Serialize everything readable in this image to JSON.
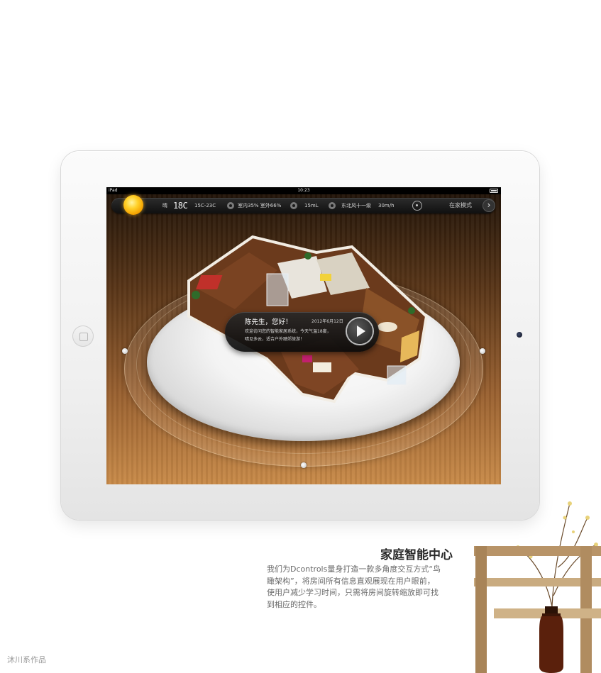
{
  "device": {
    "statusbar": {
      "carrier": "iPad",
      "time": "10:23"
    }
  },
  "toolbar": {
    "weather": "晴",
    "temperature": "18C",
    "temp_range": "15C-23C",
    "humidity": "室内35%  室外66%",
    "water": "15mL",
    "wind": "东北风十一级",
    "wind_speed": "30m/h",
    "mode": "在家模式",
    "next_icon": "›"
  },
  "card": {
    "greeting": "陈先生，您好！",
    "date": "2012年6月12日",
    "message_line1": "欢迎访问您的智能家居系统，今天气温18度，",
    "message_line2": "晴见多云，适合户外踏郊旅游！"
  },
  "caption": {
    "title": "家庭智能中心",
    "body": [
      "我们为Dcontrols量身打造一款多角度交互方式“鸟",
      "瞰架构”，将房间所有信息直观展现在用户眼前，",
      "使用户减少学习时间，只需将房间旋转缩放即可找",
      "到相应的控件。"
    ]
  },
  "signature": "沐川系作品",
  "colors": {
    "toolbar_bg": "#1a1a1a",
    "sun": "#ffc21a",
    "wood": "#b8783c",
    "platter": "#f0f0f0"
  }
}
